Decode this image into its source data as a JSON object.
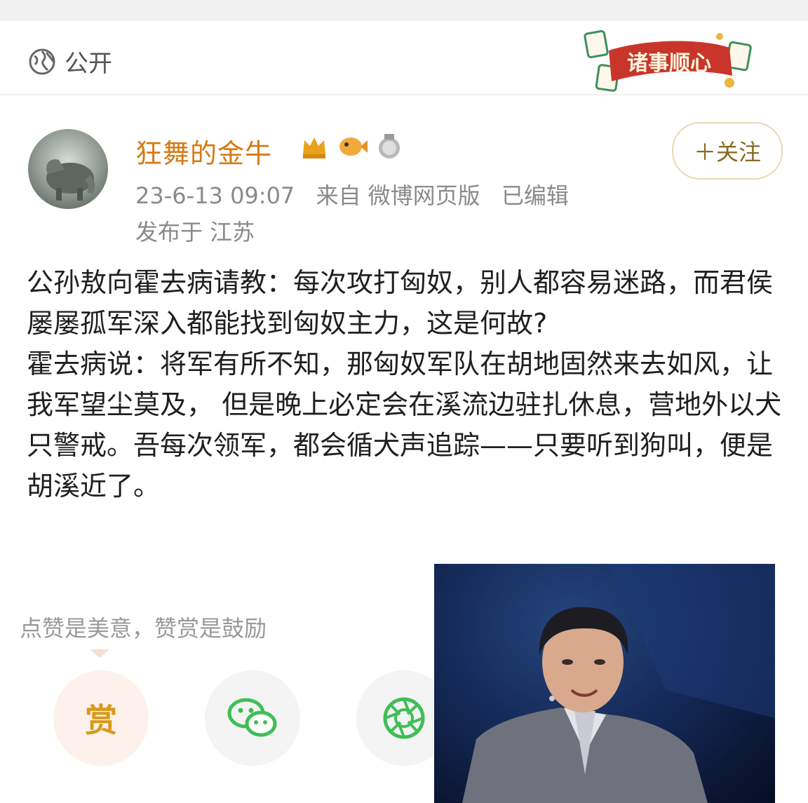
{
  "privacy": {
    "label": "公开",
    "icon": "globe-icon"
  },
  "banner": {
    "text": "诸事顺心"
  },
  "post": {
    "username": "狂舞的金牛",
    "badges": [
      "crown-badge-icon",
      "fish-badge-icon",
      "answer-badge-icon"
    ],
    "follow_label": "＋关注",
    "time": "23-6-13 09:07",
    "source": "来自 微博网页版",
    "edited": "已编辑",
    "location": "发布于 江苏",
    "paragraphs": [
      "公孙敖向霍去病请教：每次攻打匈奴，别人都容易迷路，而君侯屡屡孤军深入都能找到匈奴主力，这是何故?",
      "霍去病说：将军有所不知，那匈奴军队在胡地固然来去如风，让我军望尘莫及， 但是晚上必定会在溪流边驻扎休息，营地外以犬只警戒。吾每次领军，都会循犬声追踪——只要听到狗叫，便是胡溪近了。"
    ]
  },
  "actions": {
    "hint": "点赞是美意，赞赏是鼓励",
    "reward_label": "赏"
  },
  "colors": {
    "username": "#d57b12",
    "accent": "#d79a1a",
    "wechat": "#3fbe56"
  }
}
